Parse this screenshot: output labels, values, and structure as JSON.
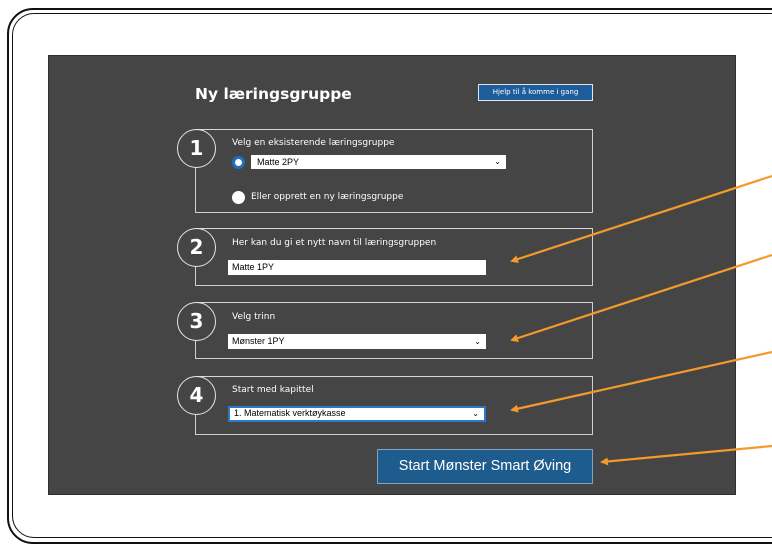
{
  "header": {
    "title": "Ny læringsgruppe",
    "help_button": "Hjelp til å komme i gang"
  },
  "steps": [
    {
      "number": "1",
      "label": "Velg en eksisterende læringsgruppe",
      "existing_group_select": {
        "value": "Matte 2PY",
        "selected": true
      },
      "create_new_label": "Eller opprett en ny læringsgruppe"
    },
    {
      "number": "2",
      "label": "Her kan du gi et nytt navn til læringsgruppen",
      "name_input_value": "Matte 1PY"
    },
    {
      "number": "3",
      "label": "Velg trinn",
      "select_value": "Mønster 1PY"
    },
    {
      "number": "4",
      "label": "Start med kapittel",
      "select_value": "1. Matematisk verktøykasse"
    }
  ],
  "start_button": "Start Mønster Smart Øving",
  "colors": {
    "panel": "#454545",
    "primary_button": "#1f5c8e",
    "annotation_arrow": "#f39a28"
  },
  "icons": {
    "select_caret": "chevron-down-icon"
  }
}
